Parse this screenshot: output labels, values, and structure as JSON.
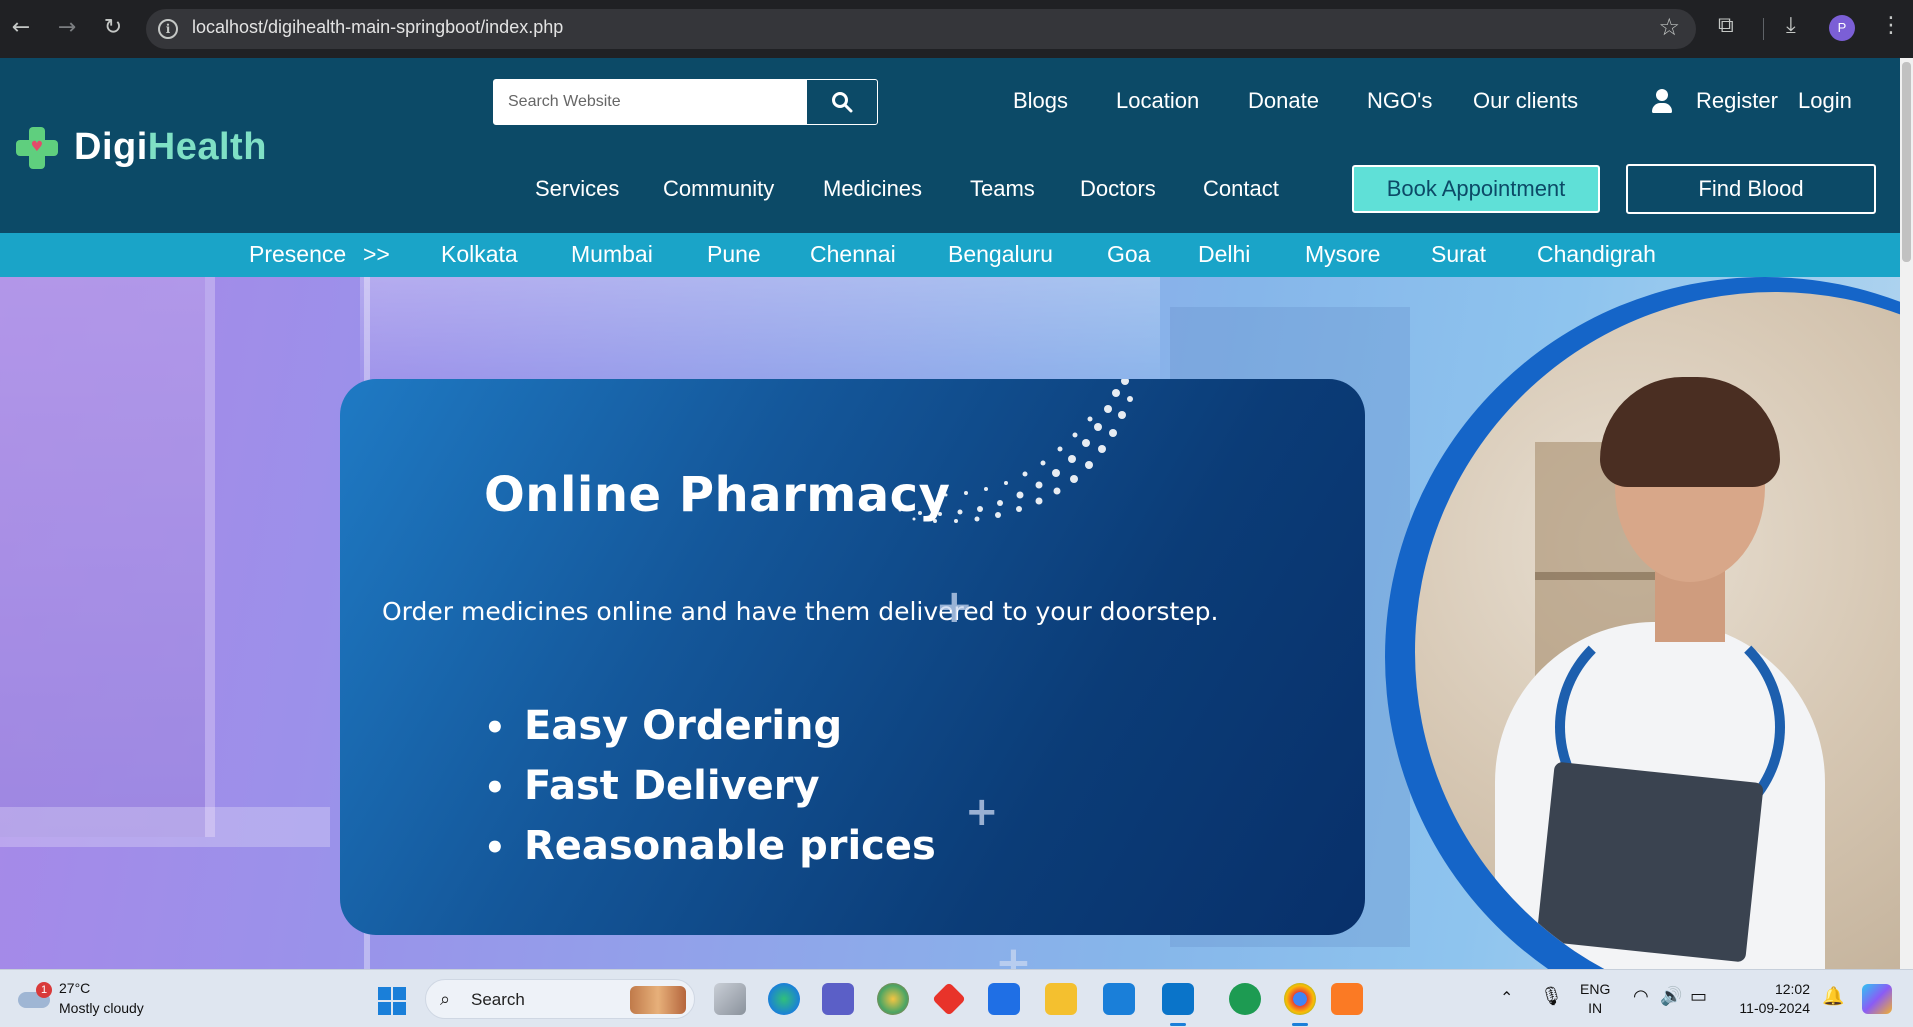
{
  "browser": {
    "url": "localhost/digihealth-main-springboot/index.php",
    "avatar_letter": "P"
  },
  "site": {
    "logo": {
      "part1": "Digi",
      "part2": "Health"
    },
    "search": {
      "placeholder": "Search Website"
    },
    "top_nav": [
      "Blogs",
      "Location",
      "Donate",
      "NGO's",
      "Our clients"
    ],
    "account": {
      "register": "Register",
      "login": "Login"
    },
    "main_nav": [
      "Services",
      "Community",
      "Medicines",
      "Teams",
      "Doctors",
      "Contact"
    ],
    "buttons": {
      "book": "Book Appointment",
      "blood": "Find Blood"
    },
    "citybar": {
      "presence": "Presence",
      "arrow": ">>",
      "cities": [
        "Kolkata",
        "Mumbai",
        "Pune",
        "Chennai",
        "Bengaluru",
        "Goa",
        "Delhi",
        "Mysore",
        "Surat",
        "Chandigrah"
      ]
    },
    "hero": {
      "title": "Online Pharmacy",
      "subtitle": "Order medicines online and have them delivered to your doorstep.",
      "bullets": [
        "Easy Ordering",
        "Fast Delivery",
        "Reasonable prices"
      ]
    }
  },
  "taskbar": {
    "weather": {
      "temp": "27°C",
      "condition": "Mostly cloudy",
      "badge": "1"
    },
    "search_label": "Search",
    "lang": {
      "line1": "ENG",
      "line2": "IN"
    },
    "clock": {
      "time": "12:02",
      "date": "11-09-2024"
    }
  },
  "colors": {
    "header_bg": "#0c4a67",
    "citybar_bg": "#1aa4c8",
    "book_btn": "#5fe0d7",
    "logo_green": "#5fcf7e",
    "card_blue": "#14579a"
  }
}
